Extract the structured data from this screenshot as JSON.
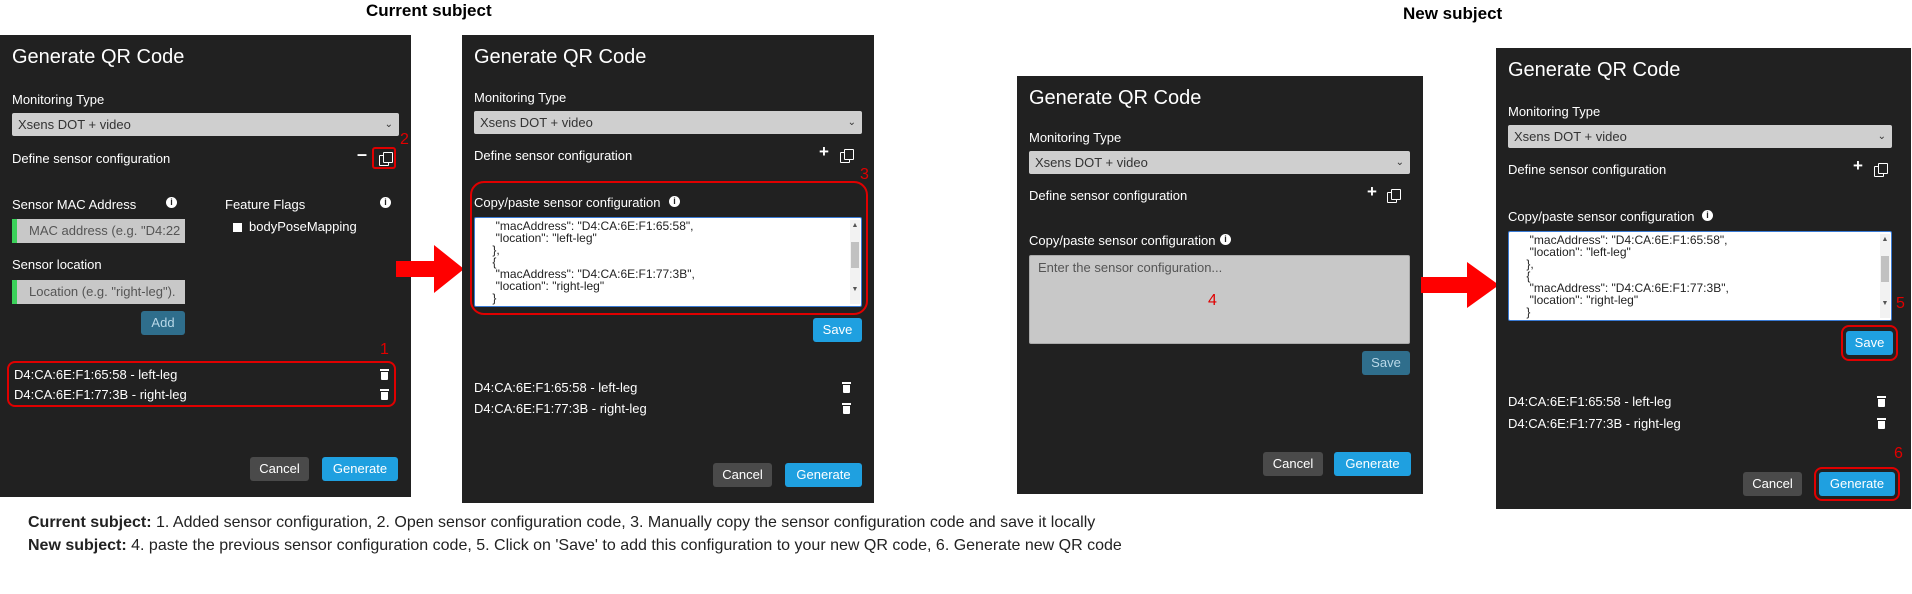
{
  "headings": {
    "current": "Current subject",
    "new": "New subject"
  },
  "panel1": {
    "title": "Generate QR Code",
    "monitoring_label": "Monitoring Type",
    "monitoring_value": "Xsens DOT + video",
    "define_label": "Define sensor configuration",
    "mac_label": "Sensor MAC Address",
    "mac_placeholder": "MAC address (e.g. \"D4:22",
    "flags_label": "Feature Flags",
    "flag_option": "bodyPoseMapping",
    "location_label": "Sensor location",
    "location_placeholder": "Location (e.g. \"right-leg\").",
    "add_label": "Add",
    "entries": [
      "D4:CA:6E:F1:65:58 - left-leg",
      "D4:CA:6E:F1:77:3B - right-leg"
    ],
    "cancel_label": "Cancel",
    "generate_label": "Generate"
  },
  "panel2": {
    "title": "Generate QR Code",
    "monitoring_label": "Monitoring Type",
    "monitoring_value": "Xsens DOT + video",
    "define_label": "Define sensor configuration",
    "copy_label": "Copy/paste sensor configuration",
    "config_lines": [
      "  \"macAddress\": \"D4:CA:6E:F1:65:58\",",
      "  \"location\": \"left-leg\"",
      " },",
      " {",
      "  \"macAddress\": \"D4:CA:6E:F1:77:3B\",",
      "  \"location\": \"right-leg\"",
      " }"
    ],
    "save_label": "Save",
    "entries": [
      "D4:CA:6E:F1:65:58 - left-leg",
      "D4:CA:6E:F1:77:3B - right-leg"
    ],
    "cancel_label": "Cancel",
    "generate_label": "Generate"
  },
  "panel3": {
    "title": "Generate QR Code",
    "monitoring_label": "Monitoring Type",
    "monitoring_value": "Xsens DOT + video",
    "define_label": "Define sensor configuration",
    "copy_label": "Copy/paste sensor configuration",
    "config_placeholder": "Enter the sensor configuration...",
    "save_label": "Save",
    "cancel_label": "Cancel",
    "generate_label": "Generate"
  },
  "panel4": {
    "title": "Generate QR Code",
    "monitoring_label": "Monitoring Type",
    "monitoring_value": "Xsens DOT + video",
    "define_label": "Define sensor configuration",
    "copy_label": "Copy/paste sensor configuration",
    "config_lines": [
      "  \"macAddress\": \"D4:CA:6E:F1:65:58\",",
      "  \"location\": \"left-leg\"",
      " },",
      " {",
      "  \"macAddress\": \"D4:CA:6E:F1:77:3B\",",
      "  \"location\": \"right-leg\"",
      " }"
    ],
    "save_label": "Save",
    "entries": [
      "D4:CA:6E:F1:65:58 - left-leg",
      "D4:CA:6E:F1:77:3B - right-leg"
    ],
    "cancel_label": "Cancel",
    "generate_label": "Generate"
  },
  "step_numbers": [
    "1",
    "2",
    "3",
    "4",
    "5",
    "6"
  ],
  "caption": {
    "line1_bold": "Current subject:",
    "line1_text": " 1. Added sensor configuration, 2. Open sensor configuration code, 3. Manually copy the sensor configuration code and save it locally",
    "line2_bold": "New subject:",
    "line2_text": " 4. paste the previous sensor configuration code, 5. Click on 'Save' to add this configuration to your new QR code, 6. Generate new QR code"
  },
  "colors": {
    "panel_bg": "#212121",
    "accent_blue": "#1fa0e0",
    "annotation_red": "#e00000",
    "input_green": "#3bd15a"
  },
  "icons": [
    "minus-icon",
    "copy-icon",
    "plus-icon",
    "info-icon",
    "trash-icon",
    "chevron-down-icon",
    "arrow-right-icon"
  ]
}
